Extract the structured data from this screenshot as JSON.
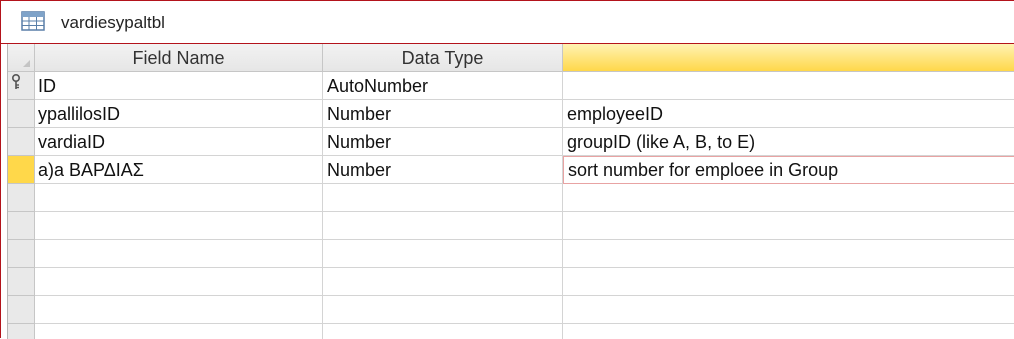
{
  "tab": {
    "title": "vardiesypaltbl",
    "icon": "table-icon"
  },
  "grid": {
    "columns": {
      "field_name": "Field Name",
      "data_type": "Data Type",
      "description": ""
    },
    "rows": [
      {
        "field_name": "ID",
        "data_type": "AutoNumber",
        "description": "",
        "primary_key": true
      },
      {
        "field_name": "ypallilosID",
        "data_type": "Number",
        "description": "employeeID"
      },
      {
        "field_name": "vardiaID",
        "data_type": "Number",
        "description": "groupID (like A, B, to E)"
      },
      {
        "field_name": "a)a ΒΑΡΔΙΑΣ",
        "data_type": "Number",
        "description": "sort number for emploee in Group",
        "current": true
      },
      {
        "field_name": "",
        "data_type": "",
        "description": ""
      },
      {
        "field_name": "",
        "data_type": "",
        "description": ""
      },
      {
        "field_name": "",
        "data_type": "",
        "description": ""
      },
      {
        "field_name": "",
        "data_type": "",
        "description": ""
      },
      {
        "field_name": "",
        "data_type": "",
        "description": ""
      },
      {
        "field_name": "",
        "data_type": "",
        "description": ""
      }
    ]
  },
  "colors": {
    "accent_border": "#b3131b",
    "current_row_selector": "#ffd84a",
    "active_column_header": "#ffd84a"
  }
}
